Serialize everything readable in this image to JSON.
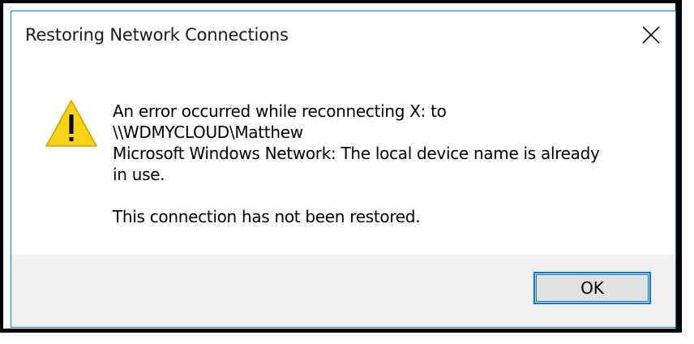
{
  "window": {
    "title": "Restoring Network Connections",
    "close_icon": "close-icon"
  },
  "message": {
    "icon": "warning-icon",
    "line1": "An error occurred while reconnecting X: to",
    "line2": "\\\\WDMYCLOUD\\Matthew",
    "line3": "Microsoft Windows Network: The local device name is already",
    "line4": "in use.",
    "line5": "This connection has not been restored."
  },
  "buttons": {
    "ok_label": "OK"
  },
  "colors": {
    "accent": "#0078d7",
    "warning_fill": "#fcd116",
    "footer_bg": "#f0f0f0"
  }
}
